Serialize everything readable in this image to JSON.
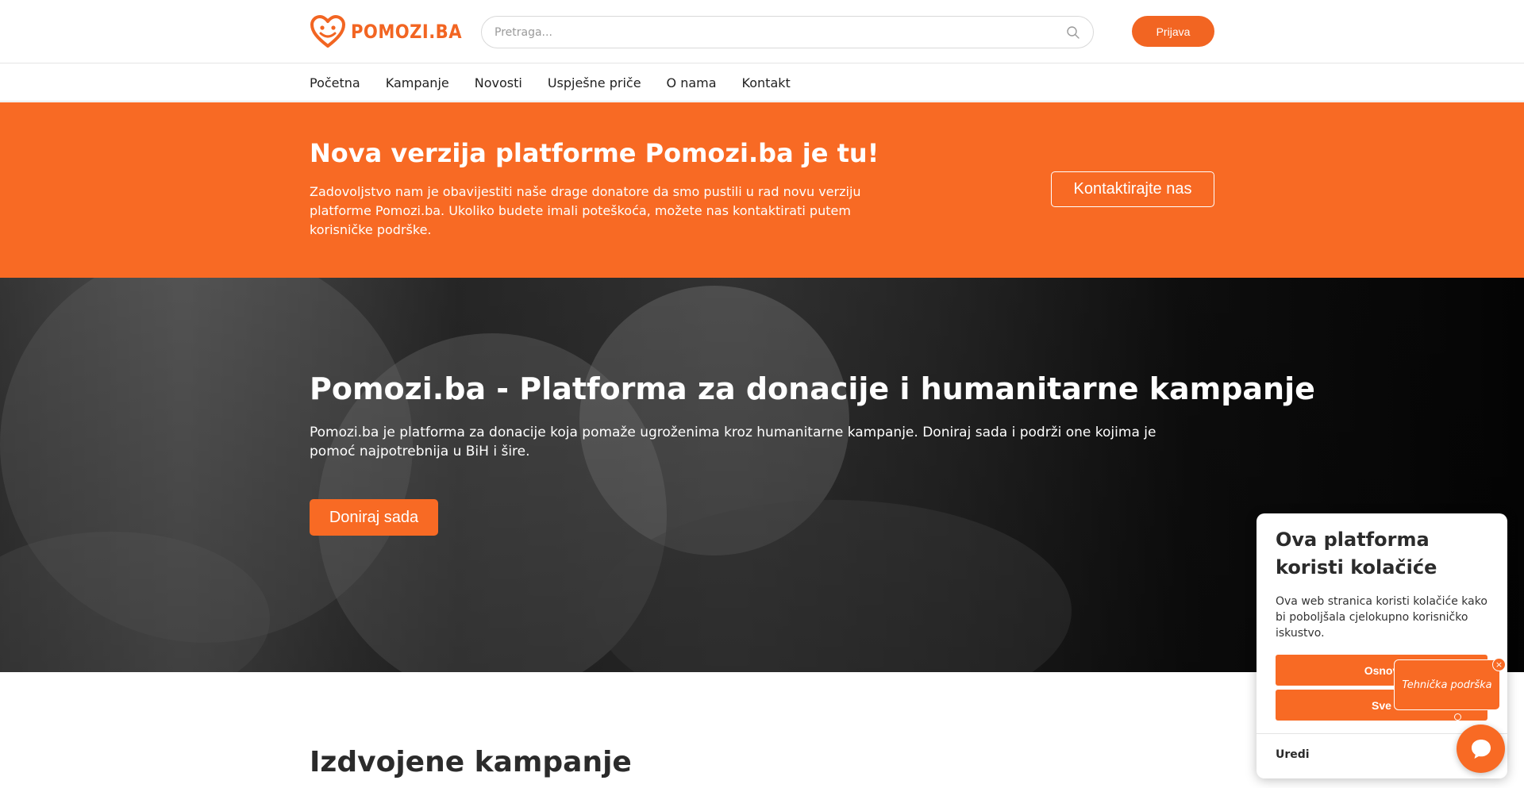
{
  "header": {
    "logo_text": "POMOZI.BA",
    "search_placeholder": "Pretraga...",
    "login_label": "Prijava"
  },
  "nav": {
    "items": [
      "Početna",
      "Kampanje",
      "Novosti",
      "Uspješne priče",
      "O nama",
      "Kontakt"
    ]
  },
  "announcement": {
    "title": "Nova verzija platforme Pomozi.ba je tu!",
    "text": "Zadovoljstvo nam je obavijestiti naše drage donatore da smo pustili u rad novu verziju platforme Pomozi.ba. Ukoliko budete imali poteškoća, možete nas kontaktirati putem korisničke podrške.",
    "button_label": "Kontaktirajte nas"
  },
  "hero": {
    "title": "Pomozi.ba - Platforma za donacije i humanitarne kampanje",
    "text": "Pomozi.ba je platforma za donacije koja pomaže ugroženima kroz humanitarne kampanje. Doniraj sada i podrži one kojima je pomoć najpotrebnija u BiH i šire.",
    "button_label": "Doniraj sada"
  },
  "featured": {
    "title": "Izdvojene kampanje"
  },
  "cookie_banner": {
    "title": "Ova platforma koristi kolačiće",
    "text": "Ova web stranica koristi kolačiće kako bi poboljšala cjelokupno korisničko iskustvo.",
    "button_basic": "Osnov",
    "button_all": "Sve",
    "edit_label": "Uredi"
  },
  "support": {
    "bubble_text": "Tehnička podrška",
    "close_glyph": "×"
  },
  "colors": {
    "brand_orange": "#f86a24",
    "logo_orange": "#f26522"
  },
  "icons": {
    "logo": "heart-logo-icon",
    "search": "search-icon",
    "chat": "chat-bubble-icon",
    "close": "close-icon"
  }
}
